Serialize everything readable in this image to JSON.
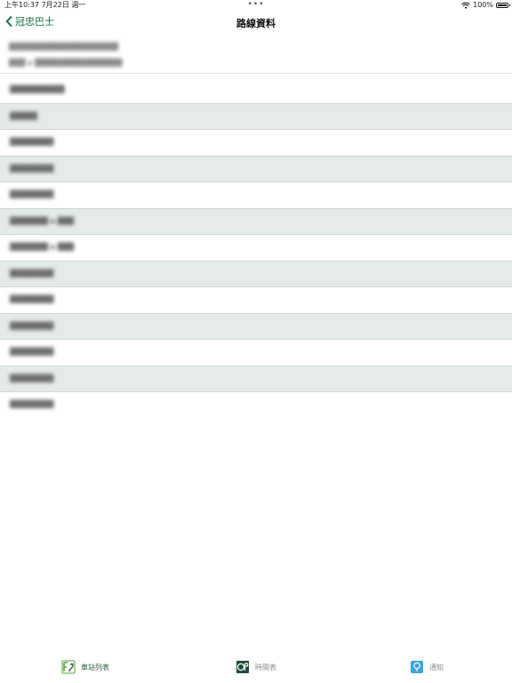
{
  "status_bar": {
    "time_date": "上午10:37  7月22日 週一",
    "dots": "•••",
    "battery": "100%"
  },
  "nav": {
    "back_label": "冠忠巴士",
    "title": "路線資料"
  },
  "route_header": {
    "line1": "████████████████████",
    "line2": "███ ▪ ████████████████"
  },
  "stops": [
    "██████████",
    "█████",
    "████████",
    "████████",
    "████████",
    "███████ ▪ ███",
    "███████ ▪ ███",
    "████████",
    "████████",
    "████████",
    "████████",
    "████████",
    "████████"
  ],
  "tab_bar": {
    "tabs": [
      {
        "label": "車站列表",
        "icon": "station-list-icon",
        "active": true
      },
      {
        "label": "時間表",
        "icon": "timetable-icon",
        "active": false
      },
      {
        "label": "通知",
        "icon": "notification-bulb-icon",
        "active": false
      }
    ]
  },
  "colors": {
    "brand_green": "#0f5c37",
    "row_alt": "#e5ece8",
    "tab_active": "#2b5d36",
    "notification_blue": "#3aa4dc"
  }
}
